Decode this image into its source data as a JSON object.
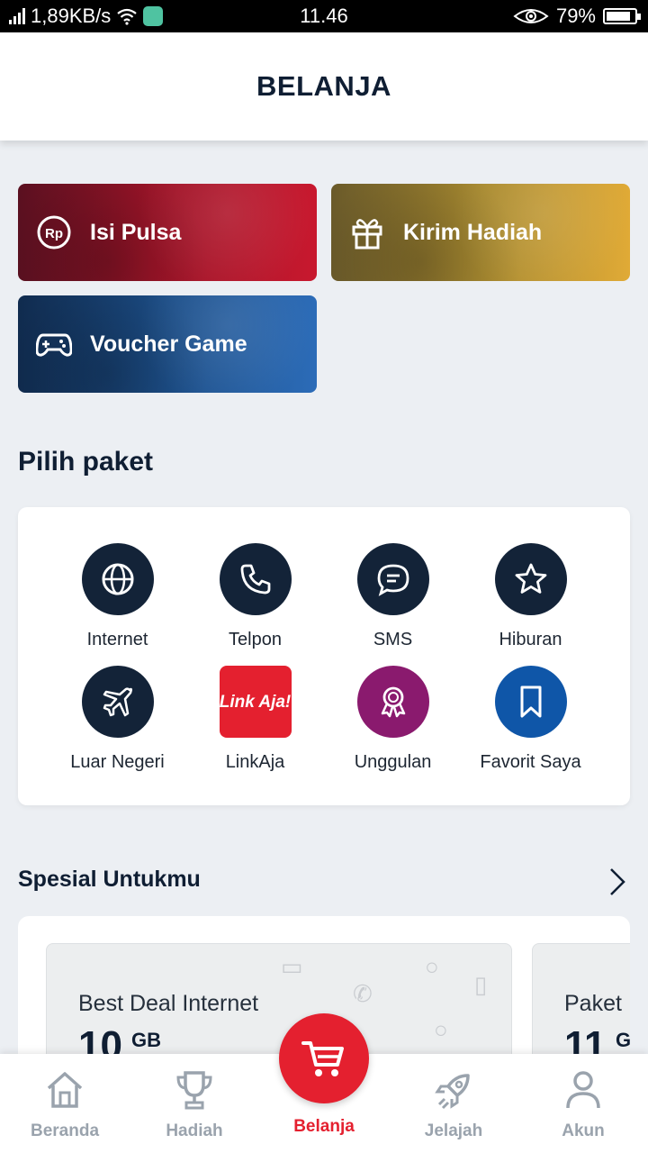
{
  "status_bar": {
    "speed": "1,89KB/s",
    "time": "11.46",
    "battery": "79%"
  },
  "header": {
    "title": "BELANJA"
  },
  "shortcuts": [
    {
      "label": "Isi Pulsa",
      "icon": "rupiah-icon",
      "color": "#c8182e"
    },
    {
      "label": "Kirim Hadiah",
      "icon": "gift-icon",
      "color": "#e0aa36"
    },
    {
      "label": "Voucher Game",
      "icon": "gamepad-icon",
      "color": "#2c6cb8"
    }
  ],
  "paket": {
    "title": "Pilih paket",
    "items": [
      {
        "label": "Internet",
        "icon": "globe-icon"
      },
      {
        "label": "Telpon",
        "icon": "phone-icon"
      },
      {
        "label": "SMS",
        "icon": "chat-icon"
      },
      {
        "label": "Hiburan",
        "icon": "star-icon"
      },
      {
        "label": "Luar Negeri",
        "icon": "plane-icon"
      },
      {
        "label": "LinkAja",
        "icon": "linkaja-logo",
        "logo_text": "Link Aja!"
      },
      {
        "label": "Unggulan",
        "icon": "award-icon"
      },
      {
        "label": "Favorit Saya",
        "icon": "bookmark-icon"
      }
    ]
  },
  "spesial": {
    "title": "Spesial Untukmu",
    "deals": [
      {
        "name": "Best Deal Internet",
        "amount": "10",
        "unit": "GB"
      },
      {
        "name": "Paket",
        "amount": "11",
        "unit": "G"
      }
    ]
  },
  "bottom_nav": {
    "items": [
      {
        "label": "Beranda",
        "icon": "home-icon"
      },
      {
        "label": "Hadiah",
        "icon": "trophy-icon"
      },
      {
        "label": "Belanja",
        "icon": "cart-icon",
        "active": true
      },
      {
        "label": "Jelajah",
        "icon": "rocket-icon"
      },
      {
        "label": "Akun",
        "icon": "user-icon"
      }
    ]
  },
  "colors": {
    "brand_red": "#e4202f",
    "navy": "#132338",
    "background": "#eceff3"
  }
}
